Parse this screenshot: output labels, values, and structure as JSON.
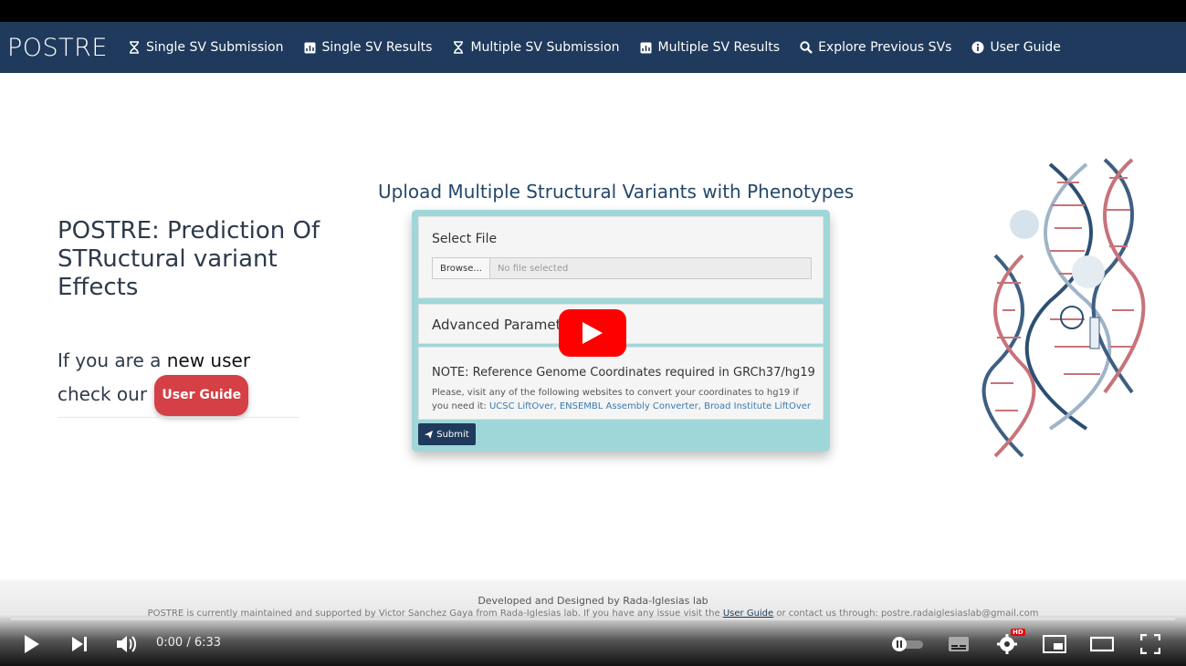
{
  "navbar": {
    "brand": "POSTRE",
    "items": [
      {
        "label": "Single SV Submission",
        "icon": "hourglass-icon"
      },
      {
        "label": "Single SV Results",
        "icon": "chart-icon"
      },
      {
        "label": "Multiple SV Submission",
        "icon": "hourglass-icon"
      },
      {
        "label": "Multiple SV Results",
        "icon": "chart-icon"
      },
      {
        "label": "Explore Previous SVs",
        "icon": "search-icon"
      },
      {
        "label": "User Guide",
        "icon": "info-icon"
      }
    ]
  },
  "left": {
    "title": "POSTRE: Prediction Of STRuctural variant Effects",
    "new_user_prefix": "If you are a",
    "new_user_bold": "new user",
    "check_our": "check our",
    "user_guide_button": "User Guide"
  },
  "upload": {
    "title": "Upload Multiple Structural Variants with Phenotypes",
    "select_file_label": "Select File",
    "browse_label": "Browse...",
    "file_placeholder": "No file selected",
    "advanced_label": "Advanced Paramete",
    "note_title": "NOTE: Reference Genome Coordinates required in GRCh37/hg19",
    "note_text": "Please, visit any of the following websites to convert your coordinates to hg19 if you need it:",
    "links": [
      "UCSC LiftOver,",
      "ENSEMBL Assembly Converter,",
      "Broad Institute LiftOver"
    ],
    "submit_label": "Submit"
  },
  "footer": {
    "line1": "Developed and Designed by Rada-Iglesias lab",
    "line2_prefix": "POSTRE is currently maintained and supported by Victor Sanchez Gaya from Rada-Iglesias lab. If you have any issue visit the",
    "line2_link": "User Guide",
    "line2_suffix": "or contact us through: postre.radaiglesiaslab@gmail.com"
  },
  "player": {
    "time": "0:00 / 6:33",
    "progress": 0,
    "hd_badge": "HD"
  },
  "colors": {
    "navbar": "#1f3a5c",
    "panel": "#9fd7d9",
    "user_guide_button": "#d53f46",
    "youtube_red": "#ff0000"
  }
}
